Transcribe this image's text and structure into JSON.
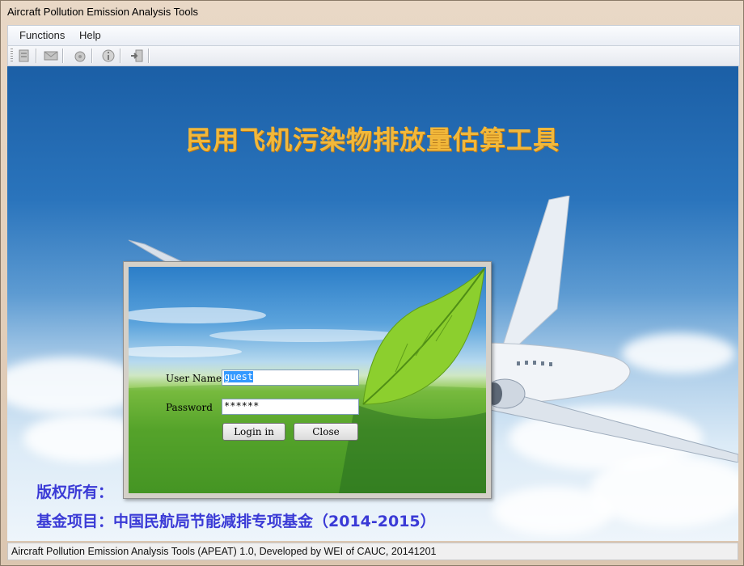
{
  "window": {
    "title": "Aircraft Pollution Emission Analysis Tools"
  },
  "menu": {
    "items": [
      "Functions",
      "Help"
    ]
  },
  "toolbar": {
    "icons": [
      "document-icon",
      "mail-icon",
      "disk-icon",
      "info-icon",
      "exit-icon"
    ]
  },
  "main": {
    "app_title": "民用飞机污染物排放量估算工具",
    "copyright_label": "版权所有：",
    "fund_label": "基金项目：中国民航局节能减排专项基金（2014-2015）"
  },
  "login": {
    "username_label": "User Name",
    "username_value": "guest",
    "password_label": "Password",
    "password_value": "******",
    "login_button": "Login in",
    "close_button": "Close"
  },
  "status": {
    "text": "Aircraft Pollution Emission Analysis Tools (APEAT) 1.0, Developed by WEI of CAUC, 20141201"
  },
  "colors": {
    "title_gold": "#f2b83a",
    "copyright_blue": "#3a3ad6",
    "selection": "#3399ff"
  }
}
